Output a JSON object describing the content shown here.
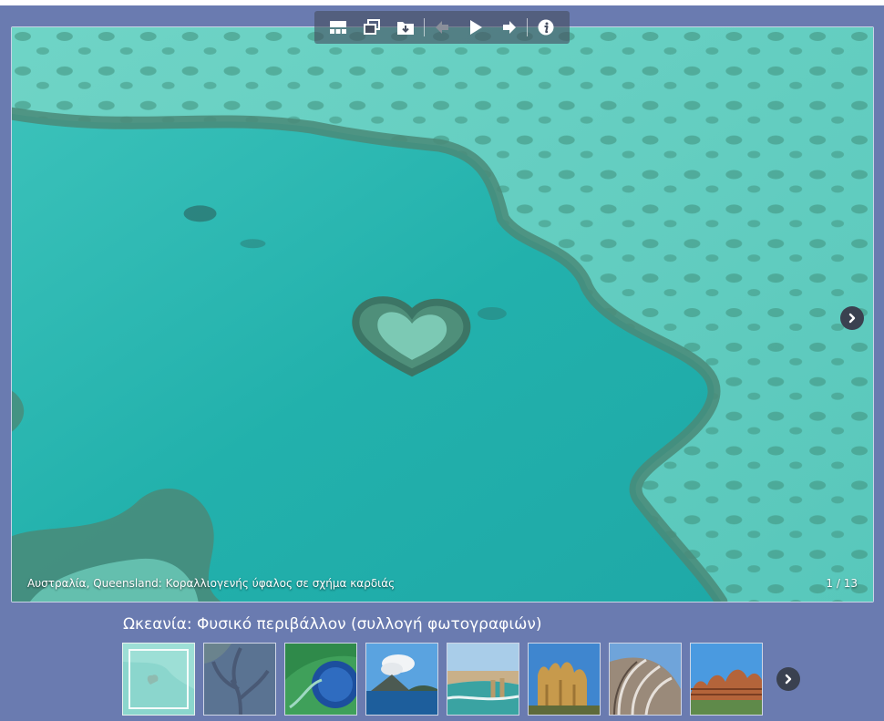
{
  "viewer": {
    "caption": "Αυστραλία, Queensland: Κοραλλιογενής ύφαλος σε σχήμα καρδιάς",
    "counter": "1 / 13"
  },
  "toolbar": {
    "buttons": [
      {
        "icon": "grid-icon"
      },
      {
        "icon": "windows-icon"
      },
      {
        "icon": "download-folder-icon"
      },
      {
        "icon": "previous-arrow-icon"
      },
      {
        "icon": "play-icon"
      },
      {
        "icon": "next-arrow-icon"
      },
      {
        "icon": "info-icon"
      }
    ]
  },
  "collection": {
    "title": "Ωκεανία: Φυσικό περιβάλλον (συλλογή φωτογραφιών)"
  },
  "colors": {
    "background": "#6a7bb0",
    "toolbar": "#464e60",
    "water": "#2ab5b0",
    "reef": "#4a8a78"
  }
}
